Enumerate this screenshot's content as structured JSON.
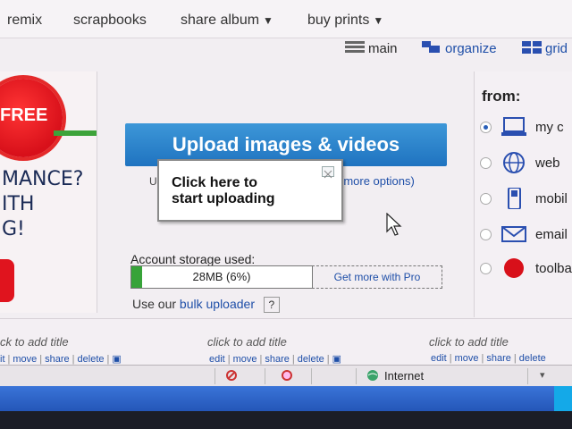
{
  "nav": {
    "remix": "remix",
    "scrapbooks": "scrapbooks",
    "share_album": "share album",
    "buy_prints": "buy prints",
    "caret": "▼"
  },
  "views": {
    "main": "main",
    "organize": "organize",
    "grid": "grid"
  },
  "ad": {
    "badge": "FREE",
    "line1": "MANCE?",
    "line2": "ITH",
    "line3": "G!"
  },
  "upload": {
    "button": "Upload images & videos",
    "u": "U",
    "more_options": "(more options)",
    "tooltip_line1": "Click here to",
    "tooltip_line2": "start uploading"
  },
  "storage": {
    "label": "Account storage used:",
    "value": "28MB (6%)",
    "percent": 6,
    "get_more": "Get more with Pro"
  },
  "bulk": {
    "prefix": "Use our",
    "link": "bulk uploader",
    "help": "?"
  },
  "from": {
    "title": "from:",
    "options": [
      {
        "label": "my c",
        "selected": true,
        "icon": "computer-icon"
      },
      {
        "label": "web",
        "selected": false,
        "icon": "globe-icon"
      },
      {
        "label": "mobil",
        "selected": false,
        "icon": "mobile-phone-icon"
      },
      {
        "label": "email",
        "selected": false,
        "icon": "envelope-icon"
      },
      {
        "label": "toolba",
        "selected": false,
        "icon": "ask-toolbar-icon"
      }
    ]
  },
  "photos": [
    {
      "title": "ck to add title",
      "actions": [
        "it",
        "move",
        "share",
        "delete"
      ]
    },
    {
      "title": "click to add title",
      "actions": [
        "edit",
        "move",
        "share",
        "delete"
      ]
    },
    {
      "title": "click to add title",
      "actions": [
        "edit",
        "move",
        "share",
        "delete"
      ]
    }
  ],
  "status": {
    "zone": "Internet"
  },
  "colors": {
    "upload_blue": "#2a84cc",
    "link_blue": "#1f4fa8",
    "storage_green": "#37a339",
    "badge_red": "#d8101a"
  }
}
